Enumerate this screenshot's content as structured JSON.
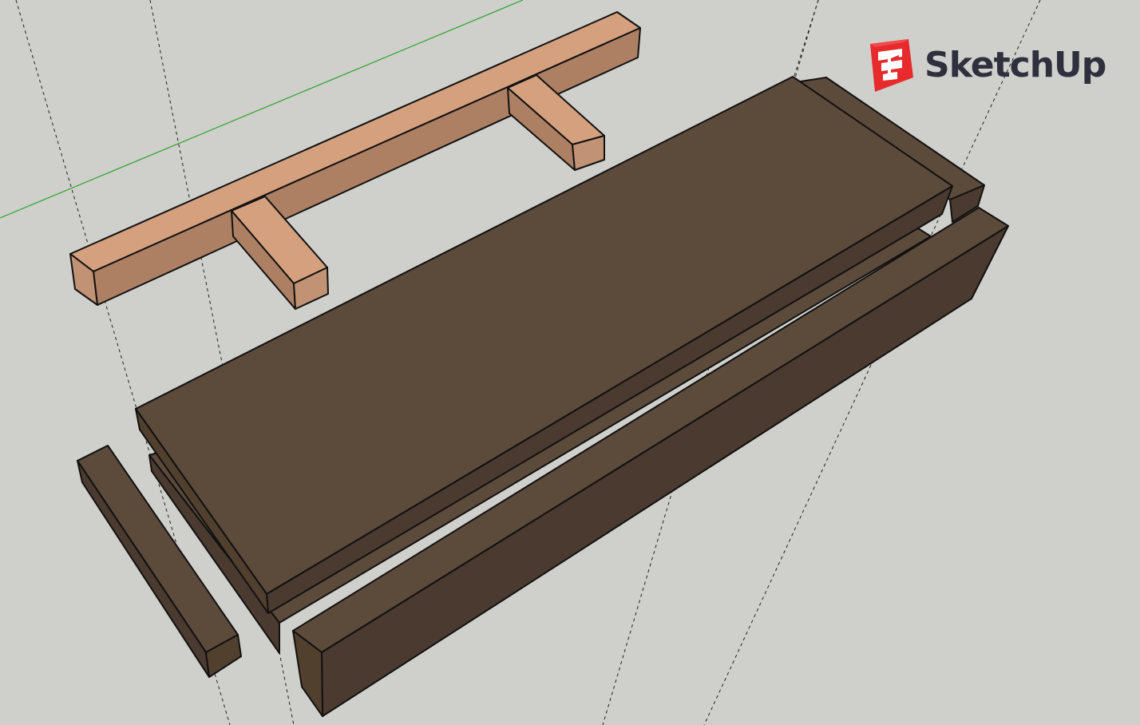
{
  "app": {
    "brand_name": "SketchUp"
  },
  "icons": {
    "brand_mark": "sketchup-logo-icon"
  },
  "colors": {
    "background": "#cfcfcb",
    "light_wood_top": "#d4a07e",
    "light_wood_side": "#ad8064",
    "dark_wood_top": "#5c4a3b",
    "dark_wood_side": "#4a3a2f",
    "green_axis": "#2aa52a",
    "logo_red": "#e72b2d"
  }
}
